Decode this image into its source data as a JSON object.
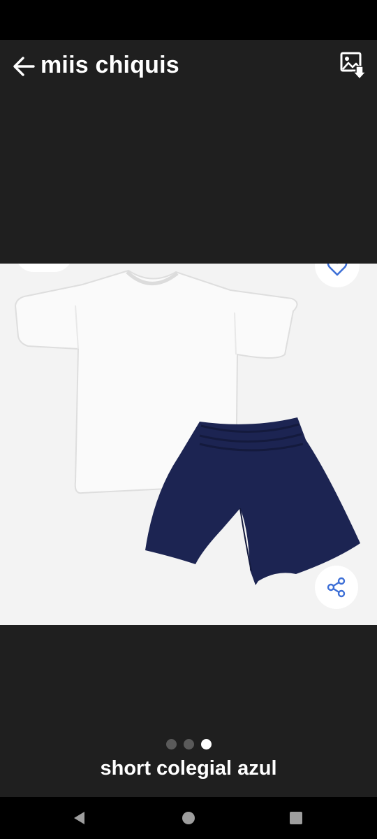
{
  "header": {
    "title": "miis chiquis",
    "back_icon": "arrow-left-icon",
    "save_icon": "save-image-icon"
  },
  "viewer": {
    "image_description": "white t-shirt and navy blue shorts",
    "favorite_icon": "heart-icon",
    "share_icon": "share-icon",
    "current_image": 3,
    "image_count": 3
  },
  "caption": "short colegial azul",
  "nav": {
    "back_icon": "triangle-back-icon",
    "home_icon": "circle-home-icon",
    "recents_icon": "square-recents-icon"
  },
  "colors": {
    "background": "#1f1f1f",
    "shorts": "#1c2452",
    "shirt": "#fafafa",
    "accent": "#3d6fd6"
  }
}
